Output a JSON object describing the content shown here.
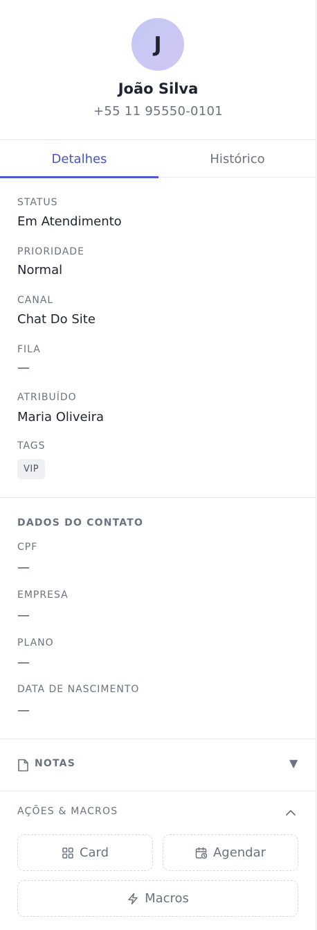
{
  "contact": {
    "initial": "J",
    "name": "João Silva",
    "phone": "+55 11 95550-0101"
  },
  "tabs": [
    {
      "label": "Detalhes",
      "active": true
    },
    {
      "label": "Histórico",
      "active": false
    }
  ],
  "details": {
    "status": {
      "label": "Status",
      "value": "Em Atendimento"
    },
    "priority": {
      "label": "Prioridade",
      "value": "Normal"
    },
    "channel": {
      "label": "Canal",
      "value": "Chat Do Site"
    },
    "queue": {
      "label": "Fila",
      "value": "—"
    },
    "assigned": {
      "label": "Atribuído",
      "value": "Maria Oliveira"
    },
    "tags": {
      "label": "Tags",
      "items": [
        "VIP"
      ]
    }
  },
  "contact_data": {
    "title": "Dados do Contato",
    "cpf": {
      "label": "CPF",
      "value": "—"
    },
    "company": {
      "label": "Empresa",
      "value": "—"
    },
    "plan": {
      "label": "Plano",
      "value": "—"
    },
    "birthdate": {
      "label": "Data de Nascimento",
      "value": "—"
    }
  },
  "notes": {
    "title": "NOTAS",
    "icon": "file-icon",
    "caret": "▼"
  },
  "actions": {
    "title": "AÇÕES & MACROS",
    "card_label": "Card",
    "schedule_label": "Agendar",
    "macros_label": "Macros",
    "icons": [
      "grid-icon",
      "calendar-clock-icon",
      "lightning-icon",
      "chevron-up-icon"
    ]
  },
  "colors": {
    "accent": "#4f5bd5",
    "muted_text": "#6b7280",
    "border": "#e5e7eb",
    "avatar": "#c3c8f5"
  }
}
